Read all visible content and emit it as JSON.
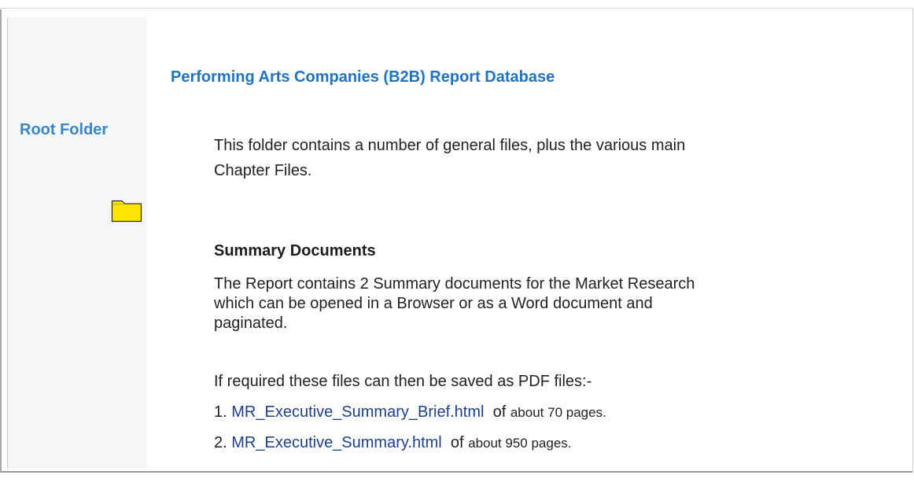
{
  "sidebar": {
    "label": "Root Folder",
    "icon": "folder-icon"
  },
  "page": {
    "title": "Performing Arts Companies (B2B) Report Database",
    "intro": "This folder contains a number of general files, plus the various main Chapter Files."
  },
  "summary": {
    "heading": "Summary Documents",
    "paragraph1": "The Report contains 2 Summary documents for the Market Research which can be opened in a Browser or as a Word document and paginated.",
    "paragraph2": "If required these files can then be saved as PDF files:-",
    "items": [
      {
        "number": "1.",
        "link": "MR_Executive_Summary_Brief.html",
        "of": "of",
        "pages": "about 70 pages."
      },
      {
        "number": "2.",
        "link": "MR_Executive_Summary.html",
        "of": "of",
        "pages": "about 950 pages."
      }
    ]
  },
  "colors": {
    "title": "#1e73c2",
    "sidebar_label": "#3a85c6",
    "link": "#1d3f8a",
    "sidebar_bg": "#f5f7f7",
    "folder_fill": "#ffe600"
  }
}
